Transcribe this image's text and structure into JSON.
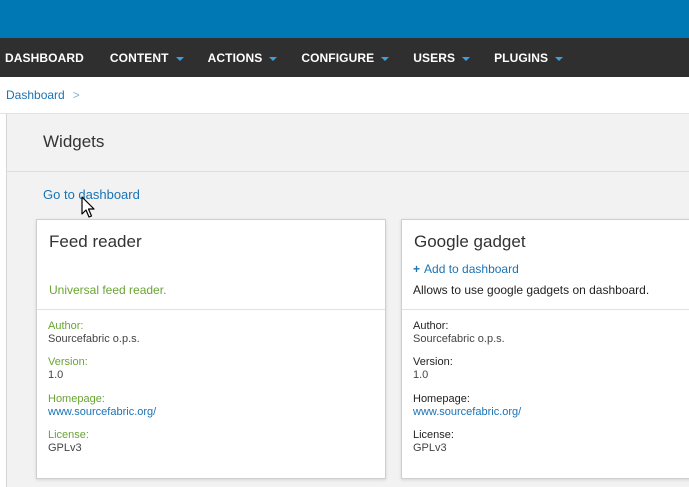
{
  "nav": {
    "items": [
      {
        "label": "DASHBOARD",
        "dropdown": false
      },
      {
        "label": "CONTENT",
        "dropdown": true
      },
      {
        "label": "ACTIONS",
        "dropdown": true
      },
      {
        "label": "CONFIGURE",
        "dropdown": true
      },
      {
        "label": "USERS",
        "dropdown": true
      },
      {
        "label": "PLUGINS",
        "dropdown": true
      }
    ]
  },
  "breadcrumb": {
    "item": "Dashboard",
    "separator": ">"
  },
  "page": {
    "title": "Widgets",
    "go_link": "Go to dashboard"
  },
  "widgets": [
    {
      "title": "Feed reader",
      "description": "Universal feed reader.",
      "author_label": "Author:",
      "author": "Sourcefabric o.p.s.",
      "version_label": "Version:",
      "version": "1.0",
      "homepage_label": "Homepage:",
      "homepage": "www.sourcefabric.org/",
      "license_label": "License:",
      "license": "GPLv3"
    },
    {
      "title": "Google gadget",
      "add_label": "Add to dashboard",
      "add_icon": "plus",
      "description": "Allows to use google gadgets on dashboard.",
      "author_label": "Author:",
      "author": "Sourcefabric o.p.s.",
      "version_label": "Version:",
      "version": "1.0",
      "homepage_label": "Homepage:",
      "homepage": "www.sourcefabric.org/",
      "license_label": "License:",
      "license": "GPLv3"
    }
  ],
  "colors": {
    "topbar": "#0078b3",
    "navbar": "#2f2f2f",
    "link": "#1a73b5",
    "green_text": "#6aa434",
    "page_bg": "#f2f2f2"
  }
}
